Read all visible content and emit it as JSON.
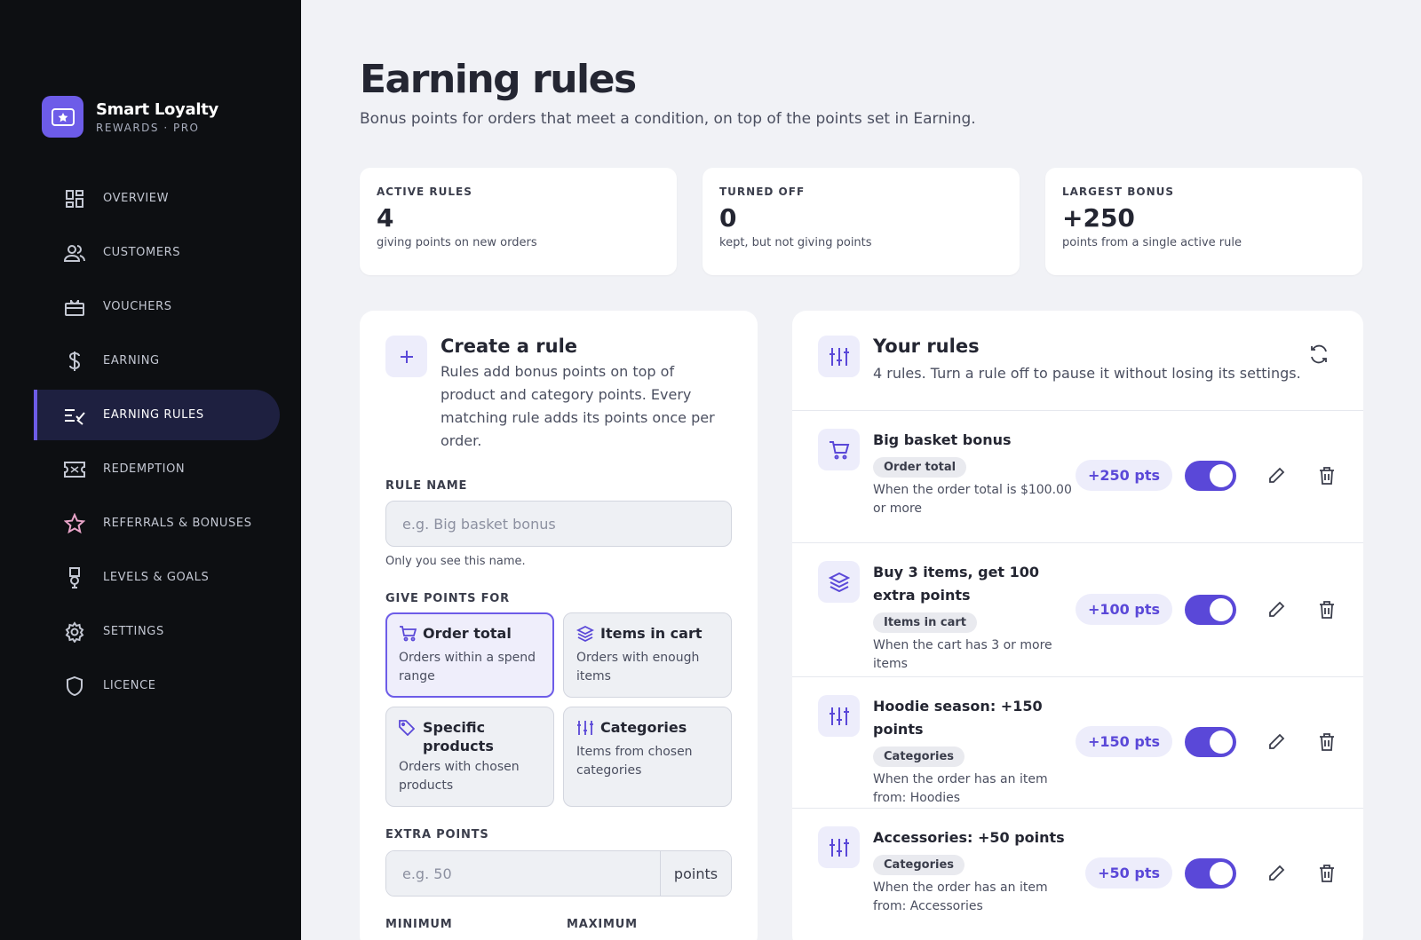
{
  "brand": {
    "name": "Smart Loyalty",
    "subtitle": "REWARDS · PRO",
    "accent": "#6d5ce8"
  },
  "nav": [
    {
      "label": "OVERVIEW",
      "icon": "dashboard-icon"
    },
    {
      "label": "CUSTOMERS",
      "icon": "users-icon"
    },
    {
      "label": "VOUCHERS",
      "icon": "gift-icon"
    },
    {
      "label": "EARNING",
      "icon": "dollar-icon"
    },
    {
      "label": "EARNING RULES",
      "icon": "list-check-icon",
      "active": true
    },
    {
      "label": "REDEMPTION",
      "icon": "ticket-icon"
    },
    {
      "label": "REFERRALS & BONUSES",
      "icon": "star-icon"
    },
    {
      "label": "LEVELS & GOALS",
      "icon": "medal-icon"
    },
    {
      "label": "SETTINGS",
      "icon": "gear-icon"
    },
    {
      "label": "LICENCE",
      "icon": "shield-icon"
    }
  ],
  "page": {
    "title": "Earning rules",
    "subtitle": "Bonus points for orders that meet a condition, on top of the points set in Earning."
  },
  "stats": [
    {
      "label": "ACTIVE RULES",
      "value": "4",
      "desc": "giving points on new orders"
    },
    {
      "label": "TURNED OFF",
      "value": "0",
      "desc": "kept, but not giving points"
    },
    {
      "label": "LARGEST BONUS",
      "value": "+250",
      "desc": "points from a single active rule"
    }
  ],
  "create": {
    "title": "Create a rule",
    "desc": "Rules add bonus points on top of product and category points. Every matching rule adds its points once per order.",
    "rule_name_label": "RULE NAME",
    "rule_name_placeholder": "e.g. Big basket bonus",
    "rule_name_hint": "Only you see this name.",
    "give_points_label": "GIVE POINTS FOR",
    "options": [
      {
        "title": "Order total",
        "desc": "Orders within a spend range",
        "icon": "cart-icon",
        "selected": true
      },
      {
        "title": "Items in cart",
        "desc": "Orders with enough items",
        "icon": "layers-icon"
      },
      {
        "title": "Specific products",
        "desc": "Orders with chosen products",
        "icon": "tag-icon"
      },
      {
        "title": "Categories",
        "desc": "Items from chosen categories",
        "icon": "sliders-icon"
      }
    ],
    "extra_points_label": "EXTRA POINTS",
    "extra_points_placeholder": "e.g. 50",
    "extra_points_suffix": "points",
    "minimum_label": "MINIMUM",
    "maximum_label": "MAXIMUM"
  },
  "rules": {
    "title": "Your rules",
    "subtitle": "4 rules. Turn a rule off to pause it without losing its settings.",
    "items": [
      {
        "name": "Big basket bonus",
        "chip": "Order total",
        "cond": "When the order total is $100.00 or more",
        "points": "+250 pts",
        "icon": "cart-icon",
        "enabled": true
      },
      {
        "name": "Buy 3 items, get 100 extra points",
        "chip": "Items in cart",
        "cond": "When the cart has 3 or more items",
        "points": "+100 pts",
        "icon": "layers-icon",
        "enabled": true
      },
      {
        "name": "Hoodie season: +150 points",
        "chip": "Categories",
        "cond": "When the order has an item from: Hoodies",
        "points": "+150 pts",
        "icon": "sliders-icon",
        "enabled": true
      },
      {
        "name": "Accessories: +50 points",
        "chip": "Categories",
        "cond": "When the order has an item from: Accessories",
        "points": "+50 pts",
        "icon": "sliders-icon",
        "enabled": true
      }
    ]
  }
}
